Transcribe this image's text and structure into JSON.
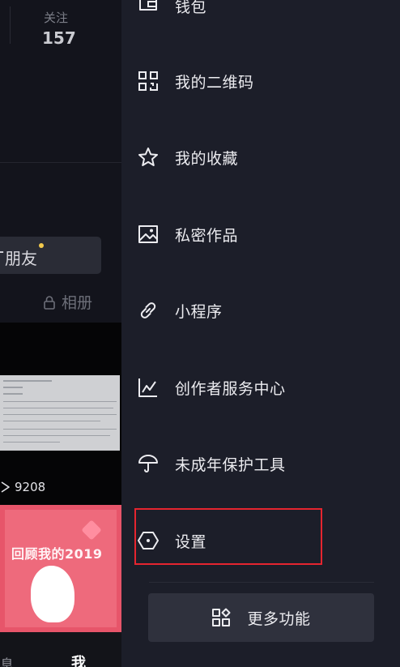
{
  "profile": {
    "stat_label": "关注",
    "stat_value": "157",
    "friend_label": "朋友",
    "friend_plus": "+",
    "album_label": "相册",
    "views": "9208",
    "thumb_title": "回顾我的2019",
    "tab_partial": "息",
    "tab_me": "我"
  },
  "drawer": {
    "items": [
      {
        "label": "钱包",
        "icon": "wallet-icon"
      },
      {
        "label": "我的二维码",
        "icon": "qr-code-icon"
      },
      {
        "label": "我的收藏",
        "icon": "star-icon"
      },
      {
        "label": "私密作品",
        "icon": "image-icon"
      },
      {
        "label": "小程序",
        "icon": "link-icon"
      },
      {
        "label": "创作者服务中心",
        "icon": "chart-icon"
      },
      {
        "label": "未成年保护工具",
        "icon": "umbrella-icon"
      },
      {
        "label": "设置",
        "icon": "hexagon-settings-icon"
      }
    ],
    "more_label": "更多功能",
    "more_icon": "grid-icon"
  },
  "colors": {
    "background": "#161722",
    "drawer": "#1c1e29",
    "highlight_border": "#e5252f",
    "button": "#2f313d"
  }
}
